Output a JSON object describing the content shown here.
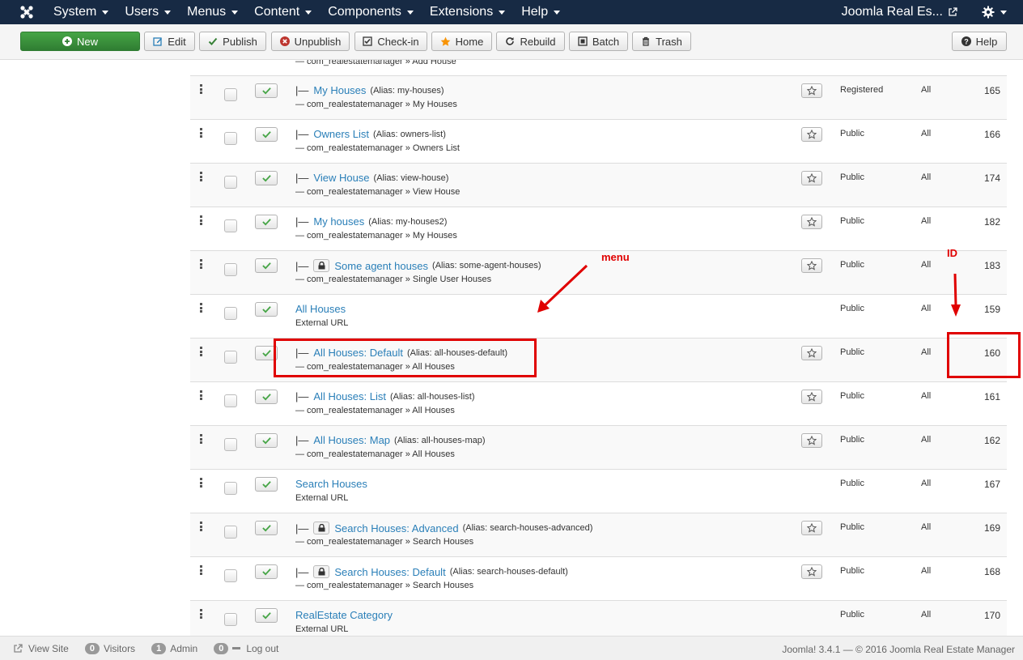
{
  "nav": {
    "items": [
      {
        "label": "System"
      },
      {
        "label": "Users"
      },
      {
        "label": "Menus"
      },
      {
        "label": "Content"
      },
      {
        "label": "Components"
      },
      {
        "label": "Extensions"
      },
      {
        "label": "Help"
      }
    ],
    "site_label": "Joomla Real Es..."
  },
  "toolbar": {
    "new": "New",
    "edit": "Edit",
    "publish": "Publish",
    "unpublish": "Unpublish",
    "checkin": "Check-in",
    "home": "Home",
    "rebuild": "Rebuild",
    "batch": "Batch",
    "trash": "Trash",
    "help": "Help"
  },
  "table": {
    "partial_row_text": "— com_realestatemanager » Add House",
    "rows": [
      {
        "prefix": "|—",
        "locked": false,
        "title": "My Houses",
        "alias": "(Alias: my-houses)",
        "subtitle": "— com_realestatemanager » My Houses",
        "home": true,
        "access": "Registered",
        "language": "All",
        "id": "165"
      },
      {
        "prefix": "|—",
        "locked": false,
        "title": "Owners List",
        "alias": "(Alias: owners-list)",
        "subtitle": "— com_realestatemanager » Owners List",
        "home": true,
        "access": "Public",
        "language": "All",
        "id": "166"
      },
      {
        "prefix": "|—",
        "locked": false,
        "title": "View House",
        "alias": "(Alias: view-house)",
        "subtitle": "— com_realestatemanager » View House",
        "home": true,
        "access": "Public",
        "language": "All",
        "id": "174"
      },
      {
        "prefix": "|—",
        "locked": false,
        "title": "My houses",
        "alias": "(Alias: my-houses2)",
        "subtitle": "— com_realestatemanager » My Houses",
        "home": true,
        "access": "Public",
        "language": "All",
        "id": "182"
      },
      {
        "prefix": "|—",
        "locked": true,
        "title": "Some agent houses",
        "alias": "(Alias: some-agent-houses)",
        "subtitle": "— com_realestatemanager » Single User Houses",
        "home": true,
        "access": "Public",
        "language": "All",
        "id": "183"
      },
      {
        "prefix": "",
        "locked": false,
        "title": "All Houses",
        "alias": "",
        "subtitle": "External URL",
        "home": false,
        "access": "Public",
        "language": "All",
        "id": "159"
      },
      {
        "prefix": "|—",
        "locked": false,
        "title": "All Houses: Default",
        "alias": "(Alias: all-houses-default)",
        "subtitle": "— com_realestatemanager » All Houses",
        "home": true,
        "access": "Public",
        "language": "All",
        "id": "160"
      },
      {
        "prefix": "|—",
        "locked": false,
        "title": "All Houses: List",
        "alias": "(Alias: all-houses-list)",
        "subtitle": "— com_realestatemanager » All Houses",
        "home": true,
        "access": "Public",
        "language": "All",
        "id": "161"
      },
      {
        "prefix": "|—",
        "locked": false,
        "title": "All Houses: Map",
        "alias": "(Alias: all-houses-map)",
        "subtitle": "— com_realestatemanager » All Houses",
        "home": true,
        "access": "Public",
        "language": "All",
        "id": "162"
      },
      {
        "prefix": "",
        "locked": false,
        "title": "Search Houses",
        "alias": "",
        "subtitle": "External URL",
        "home": false,
        "access": "Public",
        "language": "All",
        "id": "167"
      },
      {
        "prefix": "|—",
        "locked": true,
        "title": "Search Houses: Advanced",
        "alias": "(Alias: search-houses-advanced)",
        "subtitle": "— com_realestatemanager » Search Houses",
        "home": true,
        "access": "Public",
        "language": "All",
        "id": "169"
      },
      {
        "prefix": "|—",
        "locked": true,
        "title": "Search Houses: Default",
        "alias": "(Alias: search-houses-default)",
        "subtitle": "— com_realestatemanager » Search Houses",
        "home": true,
        "access": "Public",
        "language": "All",
        "id": "168"
      },
      {
        "prefix": "",
        "locked": false,
        "title": "RealEstate Category",
        "alias": "",
        "subtitle": "External URL",
        "home": false,
        "access": "Public",
        "language": "All",
        "id": "170"
      }
    ]
  },
  "annotations": {
    "menu_label": "menu",
    "id_label": "ID"
  },
  "footer": {
    "view_site": "View Site",
    "visitors_count": "0",
    "visitors_label": "Visitors",
    "admin_count": "1",
    "admin_label": "Admin",
    "messages_count": "0",
    "logout": "Log out",
    "credits": "Joomla! 3.4.1 — © 2016 Joomla Real Estate Manager"
  },
  "colors": {
    "navbar": "#172a44",
    "link": "#2a7fb8",
    "new_button": "#46a546",
    "annotation": "#e00000"
  }
}
